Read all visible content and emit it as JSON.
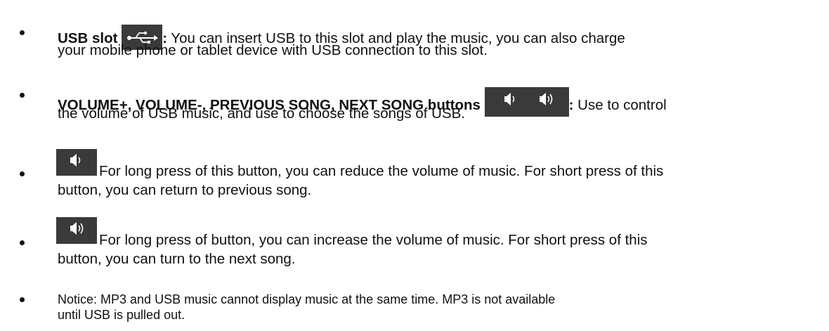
{
  "items": [
    {
      "title": "USB slot",
      "colon": ":",
      "line1_rest": " You can insert USB to this slot and play the music, you can also charge",
      "line2": "your mobile phone or tablet device with USB connection to this slot.",
      "icon": "usb-icon"
    },
    {
      "title": "VOLUME+, VOLUME-, PREVIOUS SONG, NEXT SONG buttons",
      "colon": ":",
      "line1_rest": " Use to control",
      "line2": "the volume of USB music, and use to choose the songs of USB.",
      "icon": "speaker-icons"
    },
    {
      "line1": "For long press of this button, you can reduce the volume of music. For short press of this",
      "line2": "button, you can return to previous song.",
      "icon": "volume-down-icon"
    },
    {
      "line1": "For long press of button, you can increase the volume of music. For short press of this",
      "line2": "button, you can turn to the next song.",
      "icon": "volume-up-icon"
    },
    {
      "line1": "Notice: MP3 and USB music cannot display music at the same time. MP3 is not available",
      "line2": "until USB is pulled out."
    }
  ]
}
